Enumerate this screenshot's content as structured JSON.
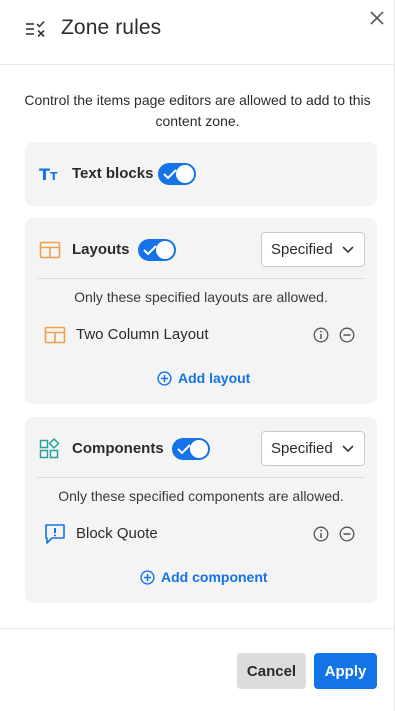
{
  "header": {
    "title": "Zone rules",
    "rules_icon": "list-rules-icon",
    "close_icon": "close-icon"
  },
  "intro": "Control the items page editors are allowed to add to this content zone.",
  "text_blocks": {
    "title": "Text blocks",
    "icon": "text-size-icon",
    "enabled": true
  },
  "layouts": {
    "title": "Layouts",
    "icon": "layout-icon",
    "enabled": true,
    "mode": "Specified",
    "note": "Only these specified layouts are allowed.",
    "items": [
      {
        "label": "Two Column Layout",
        "icon": "layout-icon"
      }
    ],
    "add_label": "Add layout"
  },
  "components": {
    "title": "Components",
    "icon": "components-icon",
    "enabled": true,
    "mode": "Specified",
    "note": "Only these specified components are allowed.",
    "items": [
      {
        "label": "Block Quote",
        "icon": "quote-icon"
      }
    ],
    "add_label": "Add component"
  },
  "footer": {
    "cancel_label": "Cancel",
    "apply_label": "Apply"
  },
  "colors": {
    "accent": "#1473e6",
    "layout_icon": "#f0a04b",
    "component_icon": "#2aa198",
    "quote_icon": "#1473e6"
  }
}
